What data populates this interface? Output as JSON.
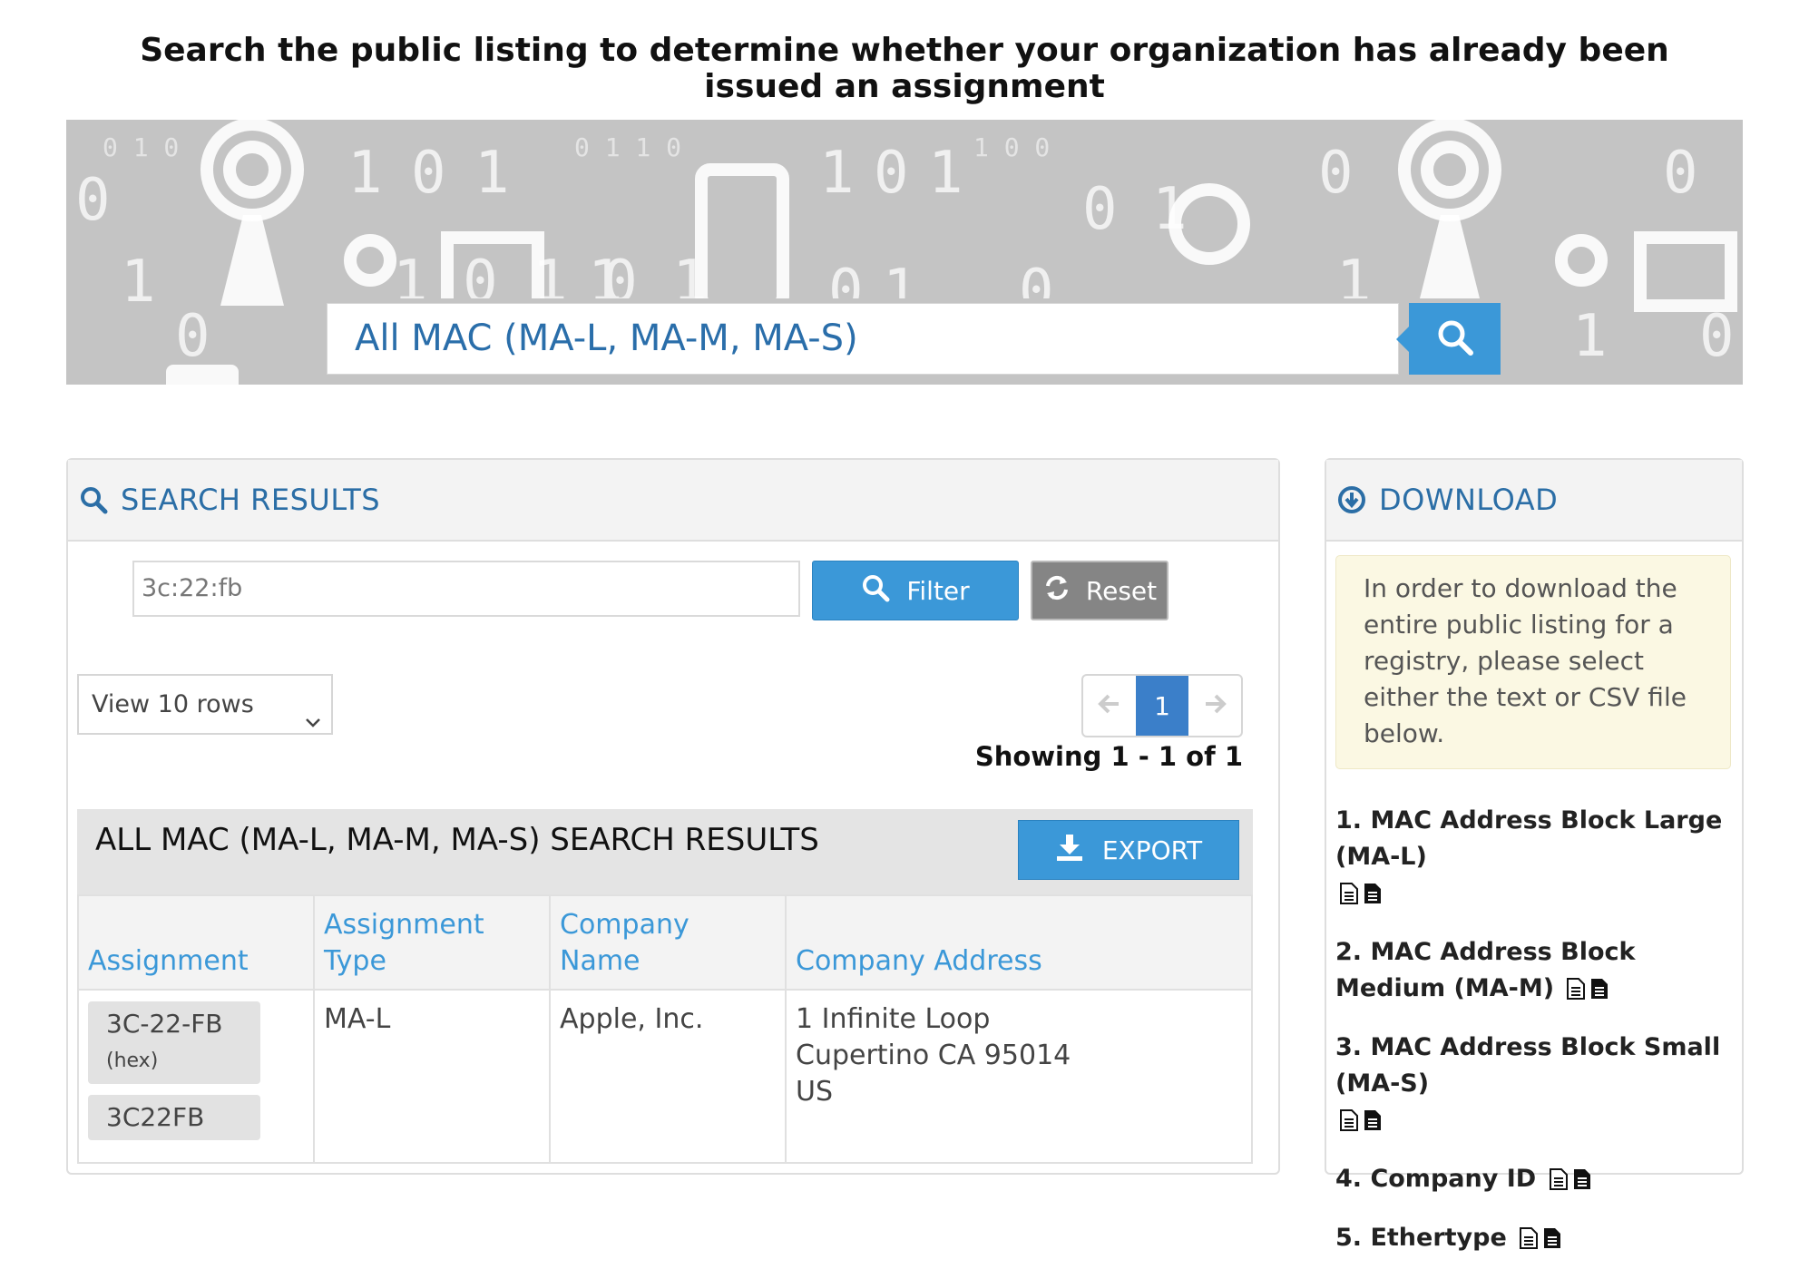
{
  "headline": "Search the public listing to determine whether your organization has already been issued an assignment",
  "registry_search": {
    "value": "All MAC (MA-L, MA-M, MA-S)",
    "button_icon": "search-icon"
  },
  "search_results": {
    "title": "SEARCH RESULTS",
    "filter_value": "3c:22:fb",
    "filter_label": "Filter",
    "reset_label": "Reset",
    "rows_select": "View 10 rows",
    "current_page": "1",
    "showing": "Showing 1 - 1 of 1",
    "table_title": "ALL MAC (MA-L, MA-M, MA-S) SEARCH RESULTS",
    "export_label": "EXPORT",
    "columns": [
      "Assignment",
      "Assignment Type",
      "Company Name",
      "Company Address"
    ],
    "rows": [
      {
        "assignment_hex": "3C-22-FB",
        "hex_suffix": "(hex)",
        "assignment_base16": "3C22FB",
        "type": "MA-L",
        "company": "Apple, Inc.",
        "address": [
          "1 Infinite Loop",
          "Cupertino CA 95014",
          "US"
        ]
      }
    ]
  },
  "download": {
    "title": "DOWNLOAD",
    "notice": "In order to download the entire public listing for a registry, please select either the text or CSV file below.",
    "items": [
      "1. MAC Address Block Large (MA-L)",
      "2. MAC Address Block Medium (MA-M)",
      "3. MAC Address Block Small (MA-S)",
      "4. Company ID",
      "5. Ethertype"
    ]
  },
  "colors": {
    "accent": "#3b98d8",
    "title_blue": "#2b6ea6",
    "reset_gray": "#858585",
    "notice_bg": "#fbf8e3"
  }
}
